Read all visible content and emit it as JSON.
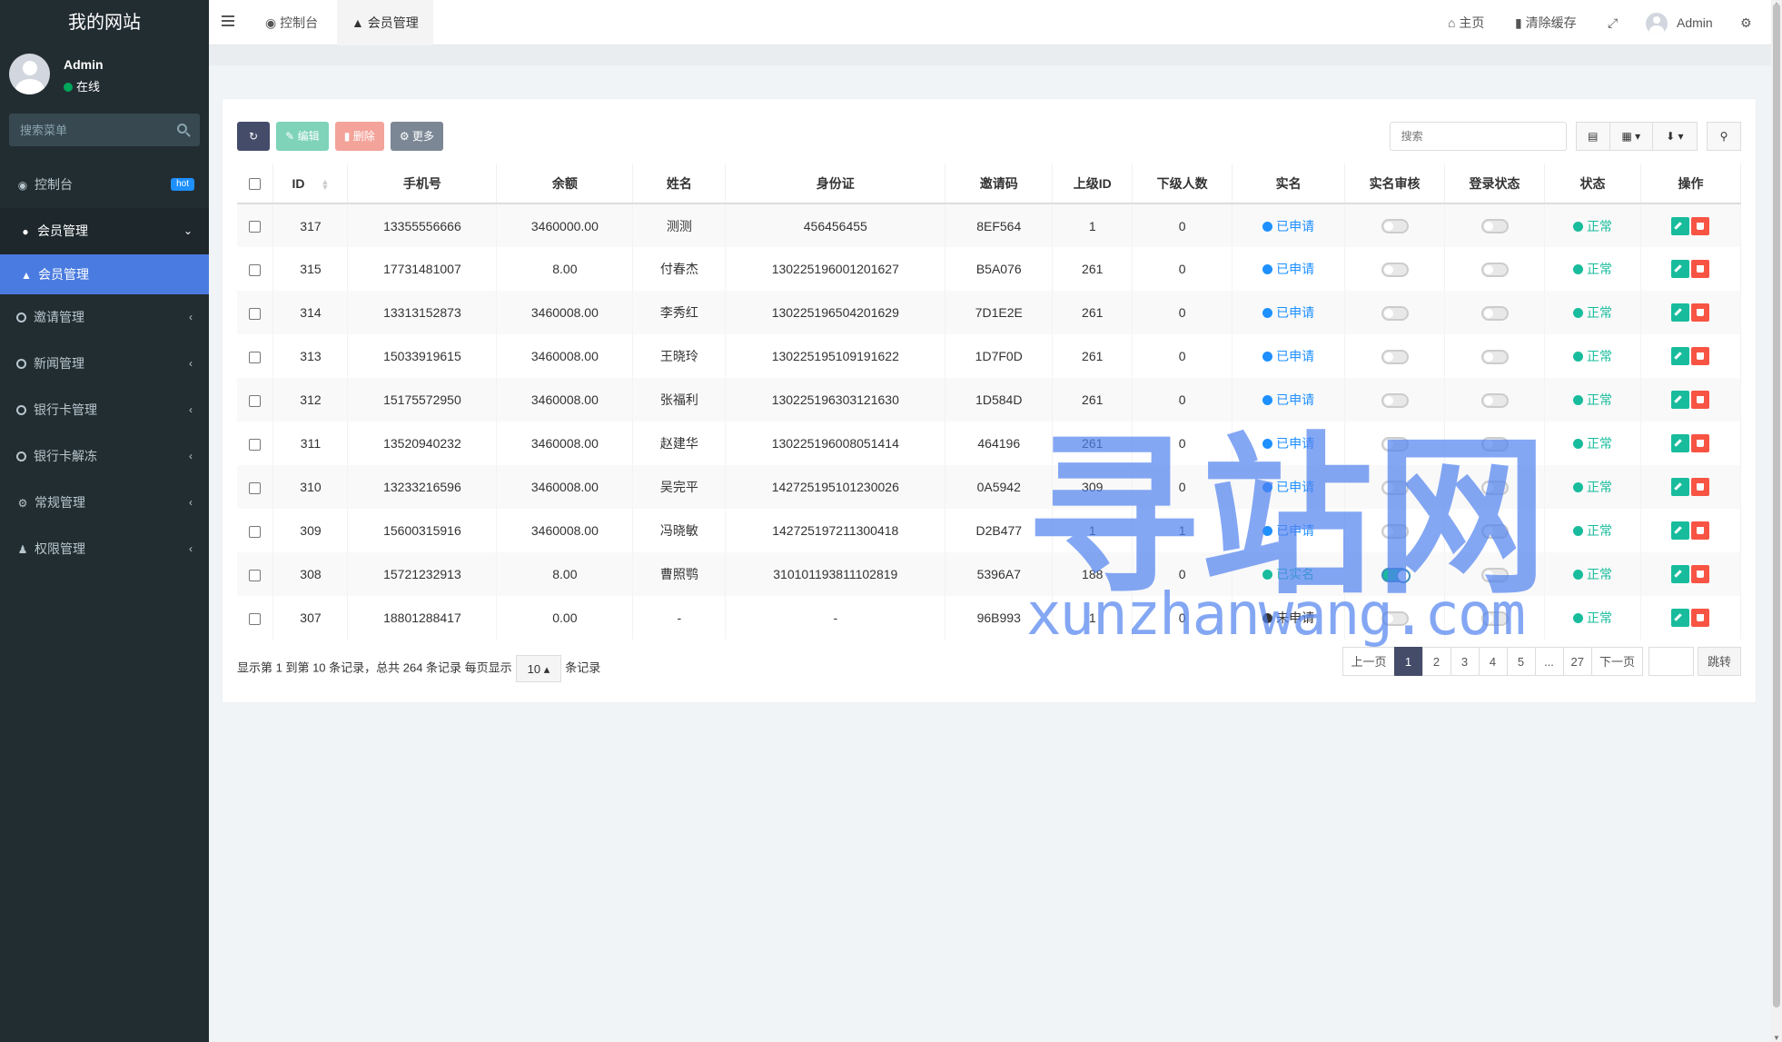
{
  "sidebar": {
    "brand": "我的网站",
    "user": {
      "name": "Admin",
      "status": "在线"
    },
    "search_placeholder": "搜索菜单",
    "items": [
      {
        "label": "控制台",
        "badge": "hot",
        "icon": "dashboard-icon"
      },
      {
        "label": "会员管理",
        "icon": "user-circle-icon",
        "expanded": true
      },
      {
        "label": "会员管理",
        "icon": "user-icon",
        "child": true
      },
      {
        "label": "邀请管理",
        "icon": "circle-icon"
      },
      {
        "label": "新闻管理",
        "icon": "circle-icon"
      },
      {
        "label": "银行卡管理",
        "icon": "circle-icon"
      },
      {
        "label": "银行卡解冻",
        "icon": "circle-icon"
      },
      {
        "label": "常规管理",
        "icon": "cogs-icon"
      },
      {
        "label": "权限管理",
        "icon": "users-icon"
      }
    ]
  },
  "header": {
    "tabs": [
      {
        "label": "控制台",
        "icon": "dashboard-icon"
      },
      {
        "label": "会员管理",
        "icon": "user-icon"
      }
    ],
    "home": "主页",
    "clear_cache": "清除缓存",
    "admin": "Admin"
  },
  "toolbar": {
    "edit": "编辑",
    "delete": "删除",
    "more": "更多",
    "search_placeholder": "搜索"
  },
  "table": {
    "headers": [
      "ID",
      "手机号",
      "余额",
      "姓名",
      "身份证",
      "邀请码",
      "上级ID",
      "下级人数",
      "实名",
      "实名审核",
      "登录状态",
      "状态",
      "操作"
    ],
    "rows": [
      {
        "id": "317",
        "phone": "13355556666",
        "balance": "3460000.00",
        "name": "测测",
        "idcard": "456456455",
        "code": "8EF564",
        "parent": "1",
        "children": "0",
        "realname": "已申请",
        "realname_color": "#1e90ff",
        "audit": false,
        "login": false,
        "status": "正常"
      },
      {
        "id": "315",
        "phone": "17731481007",
        "balance": "8.00",
        "name": "付春杰",
        "idcard": "130225196001201627",
        "code": "B5A076",
        "parent": "261",
        "children": "0",
        "realname": "已申请",
        "realname_color": "#1e90ff",
        "audit": false,
        "login": false,
        "status": "正常"
      },
      {
        "id": "314",
        "phone": "13313152873",
        "balance": "3460008.00",
        "name": "李秀红",
        "idcard": "130225196504201629",
        "code": "7D1E2E",
        "parent": "261",
        "children": "0",
        "realname": "已申请",
        "realname_color": "#1e90ff",
        "audit": false,
        "login": false,
        "status": "正常"
      },
      {
        "id": "313",
        "phone": "15033919615",
        "balance": "3460008.00",
        "name": "王晓玲",
        "idcard": "130225195109191622",
        "code": "1D7F0D",
        "parent": "261",
        "children": "0",
        "realname": "已申请",
        "realname_color": "#1e90ff",
        "audit": false,
        "login": false,
        "status": "正常"
      },
      {
        "id": "312",
        "phone": "15175572950",
        "balance": "3460008.00",
        "name": "张福利",
        "idcard": "130225196303121630",
        "code": "1D584D",
        "parent": "261",
        "children": "0",
        "realname": "已申请",
        "realname_color": "#1e90ff",
        "audit": false,
        "login": false,
        "status": "正常"
      },
      {
        "id": "311",
        "phone": "13520940232",
        "balance": "3460008.00",
        "name": "赵建华",
        "idcard": "130225196008051414",
        "code": "464196",
        "parent": "261",
        "children": "0",
        "realname": "已申请",
        "realname_color": "#1e90ff",
        "audit": false,
        "login": false,
        "status": "正常"
      },
      {
        "id": "310",
        "phone": "13233216596",
        "balance": "3460008.00",
        "name": "吴完平",
        "idcard": "142725195101230026",
        "code": "0A5942",
        "parent": "309",
        "children": "0",
        "realname": "已申请",
        "realname_color": "#1e90ff",
        "audit": false,
        "login": false,
        "status": "正常"
      },
      {
        "id": "309",
        "phone": "15600315916",
        "balance": "3460008.00",
        "name": "冯晓敏",
        "idcard": "142725197211300418",
        "code": "D2B477",
        "parent": "1",
        "children": "1",
        "realname": "已申请",
        "realname_color": "#1e90ff",
        "audit": false,
        "login": false,
        "status": "正常"
      },
      {
        "id": "308",
        "phone": "15721232913",
        "balance": "8.00",
        "name": "曹照鹗",
        "idcard": "310101193811102819",
        "code": "5396A7",
        "parent": "188",
        "children": "0",
        "realname": "已实名",
        "realname_color": "#18bc9c",
        "audit": true,
        "login": false,
        "status": "正常"
      },
      {
        "id": "307",
        "phone": "18801288417",
        "balance": "0.00",
        "name": "-",
        "idcard": "-",
        "code": "96B993",
        "parent": "1",
        "children": "0",
        "realname": "未申请",
        "realname_color": "#333333",
        "audit": false,
        "login": false,
        "status": "正常"
      }
    ]
  },
  "pagination": {
    "summary_prefix": "显示第 1 到第 10 条记录，总共 264 条记录 每页显示",
    "page_size": "10",
    "summary_suffix": "条记录",
    "prev": "上一页",
    "pages": [
      "1",
      "2",
      "3",
      "4",
      "5",
      "...",
      "27"
    ],
    "active_page": "1",
    "next": "下一页",
    "jump": "跳转"
  },
  "watermark": {
    "cn": "寻站网",
    "en": "xunzhanwang.com"
  },
  "colors": {
    "sidebar_bg": "#222d32",
    "active_menu": "#4a7be0",
    "primary_dark": "#444c69",
    "success": "#18bc9c",
    "danger": "#f75444",
    "info": "#1e90ff"
  }
}
